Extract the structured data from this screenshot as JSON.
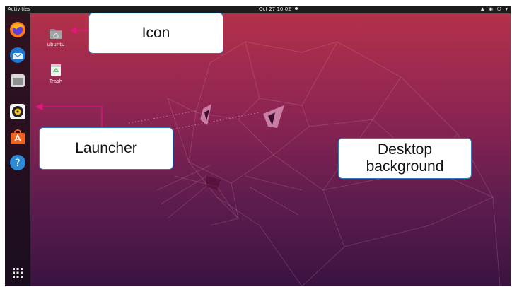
{
  "topbar": {
    "activities_label": "Activities",
    "clock_text": "Oct 27  10:02",
    "tray_icons": [
      "network-icon",
      "volume-icon",
      "power-icon",
      "chevron-down-icon"
    ]
  },
  "desktop": {
    "background_colors": [
      "#b4314a",
      "#5c1c4e"
    ],
    "icons": [
      {
        "label": "ubuntu",
        "icon": "home-folder-icon"
      },
      {
        "label": "Trash",
        "icon": "trash-icon"
      }
    ]
  },
  "dock": {
    "items": [
      "firefox-icon",
      "thunderbird-icon",
      "files-icon",
      "rhythmbox-icon",
      "software-center-icon",
      "help-icon"
    ],
    "show_apps_icon": "apps-grid-icon"
  },
  "callouts": {
    "icon": "Icon",
    "launcher": "Launcher",
    "desktop_line1": "Desktop",
    "desktop_line2": "background"
  },
  "annotation_color": "#e2177c"
}
